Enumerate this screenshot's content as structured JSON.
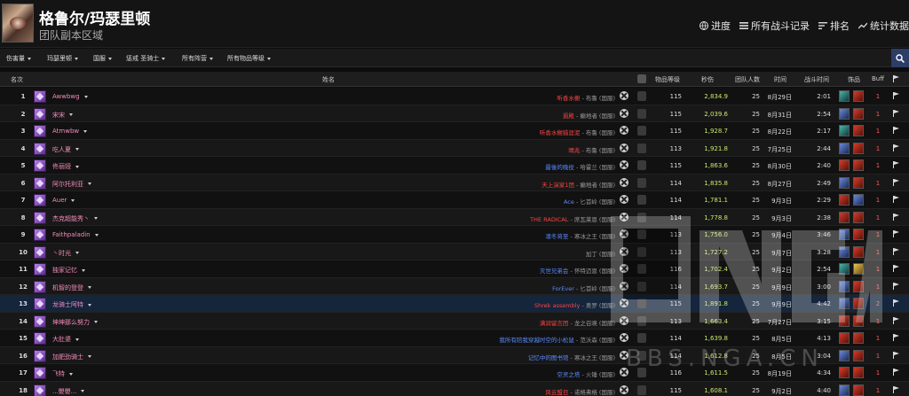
{
  "header": {
    "title": "格鲁尔/玛瑟里顿",
    "subtitle": "团队副本区域",
    "nav": [
      {
        "label": "进度",
        "icon": "globe-icon"
      },
      {
        "label": "所有战斗记录",
        "icon": "list-icon"
      },
      {
        "label": "排名",
        "icon": "ranking-icon"
      },
      {
        "label": "统计数据",
        "icon": "trend-icon"
      }
    ]
  },
  "filters": [
    "伤害量",
    "玛瑟里顿",
    "国服",
    "惩戒 圣骑士",
    "所有阵营",
    "所有物品等级"
  ],
  "columns": {
    "rank": "名次",
    "name": "姓名",
    "ilvl": "物品等级",
    "dps": "秒伤",
    "raid_size": "团队人数",
    "date": "时间",
    "fight_time": "战斗时间",
    "trinkets": "饰品",
    "buff": "Buff"
  },
  "rows": [
    {
      "rank": "1",
      "name": "Awwbwg",
      "guild": "听香水榭",
      "realm": " - 布鲁 (国服)",
      "gcolor": "#ff4444",
      "ilvl": "115",
      "dps": "2,834.9",
      "size": "25",
      "date": "8月29日",
      "time": "2:01",
      "t1": "teal",
      "t2": "red",
      "buff": "1"
    },
    {
      "rank": "2",
      "name": "宋宋",
      "guild": "遐殿",
      "realm": " - 癫地者 (国服)",
      "gcolor": "#ff4444",
      "ilvl": "115",
      "dps": "2,039.6",
      "size": "25",
      "date": "8月31日",
      "time": "2:54",
      "t1": "blue",
      "t2": "red",
      "buff": "1"
    },
    {
      "rank": "3",
      "name": "Atmwbw",
      "guild": "听香水榭猎涯泥",
      "realm": " - 布鲁 (国服)",
      "gcolor": "#ff4444",
      "ilvl": "115",
      "dps": "1,928.7",
      "size": "25",
      "date": "8月22日",
      "time": "2:17",
      "t1": "teal",
      "t2": "red",
      "buff": "1"
    },
    {
      "rank": "4",
      "name": "吃人夏",
      "guild": "晴兆",
      "realm": " - 布鲁 (国服)",
      "gcolor": "#ff4444",
      "ilvl": "113",
      "dps": "1,921.8",
      "size": "25",
      "date": "7月25日",
      "time": "2:44",
      "t1": "blue",
      "t2": "red",
      "buff": "1"
    },
    {
      "rank": "5",
      "name": "佟丽娅",
      "guild": "最後的晚役",
      "realm": " - 哈霍兰 (国服)",
      "gcolor": "#5a8aff",
      "ilvl": "115",
      "dps": "1,863.6",
      "size": "25",
      "date": "8月30日",
      "time": "2:40",
      "t1": "red",
      "t2": "red",
      "buff": "1"
    },
    {
      "rank": "6",
      "name": "阿尔托利亚",
      "guild": "天上演家1团",
      "realm": " - 癫地者 (国服)",
      "gcolor": "#ff4444",
      "ilvl": "114",
      "dps": "1,835.8",
      "size": "25",
      "date": "8月27日",
      "time": "2:49",
      "t1": "blue",
      "t2": "red",
      "buff": "1"
    },
    {
      "rank": "7",
      "name": "Auer",
      "guild": "Ace",
      "realm": " - 匕首岭 (国服)",
      "gcolor": "#5a8aff",
      "ilvl": "114",
      "dps": "1,781.1",
      "size": "25",
      "date": "9月3日",
      "time": "2:29",
      "t1": "red",
      "t2": "blue",
      "buff": "1"
    },
    {
      "rank": "8",
      "name": "杰克超能秀丶",
      "guild": "THE RADICAL",
      "realm": " - 席瓦莱恩 (国服)",
      "gcolor": "#ff4444",
      "ilvl": "114",
      "dps": "1,778.8",
      "size": "25",
      "date": "9月3日",
      "time": "2:38",
      "t1": "red",
      "t2": "red",
      "buff": "1"
    },
    {
      "rank": "9",
      "name": "Faithpaladin",
      "guild": "凛冬将至",
      "realm": " - 寒冰之王 (国服)",
      "gcolor": "#5a8aff",
      "ilvl": "113",
      "dps": "1,756.0",
      "size": "25",
      "date": "9月4日",
      "time": "3:46",
      "t1": "blue",
      "t2": "red",
      "buff": "1"
    },
    {
      "rank": "10",
      "name": "丶时光",
      "guild": "加丁",
      "realm": " (国服)",
      "gcolor": "#999999",
      "ilvl": "113",
      "dps": "1,727.2",
      "size": "25",
      "date": "9月7日",
      "time": "3:28",
      "t1": "blue",
      "t2": "red",
      "buff": "1"
    },
    {
      "rank": "11",
      "name": "独家记忆",
      "guild": "灭世兄弟会",
      "realm": " - 怀特迈恩 (国服)",
      "gcolor": "#5a8aff",
      "ilvl": "116",
      "dps": "1,702.4",
      "size": "25",
      "date": "9月2日",
      "time": "2:54",
      "t1": "teal",
      "t2": "gold",
      "buff": "1"
    },
    {
      "rank": "12",
      "name": "机智的登登",
      "guild": "ForEver",
      "realm": " - 匕首岭 (国服)",
      "gcolor": "#5a8aff",
      "ilvl": "114",
      "dps": "1,693.7",
      "size": "25",
      "date": "9月9日",
      "time": "3:00",
      "t1": "blue",
      "t2": "red",
      "buff": "1"
    },
    {
      "rank": "13",
      "name": "龙骑士阿特",
      "guild": "Shrek assembly",
      "realm": " - 奥罗 (国服)",
      "gcolor": "#ff4444",
      "ilvl": "115",
      "dps": "1,891.8",
      "size": "25",
      "date": "9月9日",
      "time": "4:42",
      "t1": "blue",
      "t2": "red",
      "buff": "2"
    },
    {
      "rank": "14",
      "name": "坤坤那么努力",
      "guild": "满润留言团",
      "realm": " - 龙之召唤 (国服)",
      "gcolor": "#ff4444",
      "ilvl": "113",
      "dps": "1,663.4",
      "size": "25",
      "date": "7月27日",
      "time": "3:15",
      "t1": "red",
      "t2": "red",
      "buff": "1"
    },
    {
      "rank": "15",
      "name": "大肚婆",
      "guild": "我所有陪我穿越时空的小松鼠",
      "realm": " - 范沃森 (国服)",
      "gcolor": "#5a8aff",
      "ilvl": "114",
      "dps": "1,639.8",
      "size": "25",
      "date": "8月5日",
      "time": "4:13",
      "t1": "red",
      "t2": "red",
      "buff": "1"
    },
    {
      "rank": "16",
      "name": "加肥劲骑士",
      "guild": "记忆中的图书馆",
      "realm": " - 寒冰之王 (国服)",
      "gcolor": "#5a8aff",
      "ilvl": "114",
      "dps": "1,612.8",
      "size": "25",
      "date": "8月5日",
      "time": "3:04",
      "t1": "blue",
      "t2": "red",
      "buff": "1"
    },
    {
      "rank": "17",
      "name": "飞特",
      "guild": "空灵之塔",
      "realm": " - 火锤 (国服)",
      "gcolor": "#5a8aff",
      "ilvl": "116",
      "dps": "1,611.5",
      "size": "25",
      "date": "8月19日",
      "time": "4:34",
      "t1": "red",
      "t2": "red",
      "buff": "1"
    },
    {
      "rank": "18",
      "name": "...嬰嬰...",
      "guild": "风云盟日",
      "realm": " - 诺格弗格 (国服)",
      "gcolor": "#ff4444",
      "ilvl": "115",
      "dps": "1,608.1",
      "size": "25",
      "date": "9月2日",
      "time": "4:40",
      "t1": "blue",
      "t2": "red",
      "buff": "1"
    }
  ],
  "watermark": "BBS.NGA.CN"
}
